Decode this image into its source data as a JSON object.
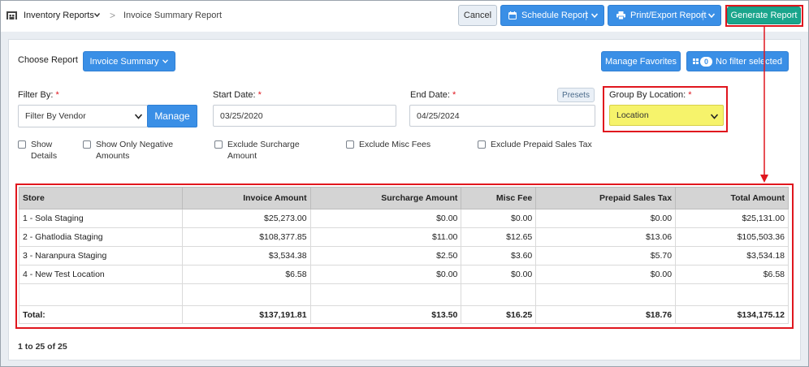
{
  "breadcrumb": {
    "module": "Inventory Reports",
    "separator": ">",
    "page": "Invoice Summary Report"
  },
  "toolbar": {
    "cancel_label": "Cancel",
    "schedule_label": "Schedule Report",
    "print_label": "Print/Export Report",
    "generate_label": "Generate Report"
  },
  "report": {
    "choose_label": "Choose Report",
    "selected": "Invoice Summary",
    "favorites_label": "Manage Favorites",
    "filter_count": "0",
    "filter_label": "No filter selected"
  },
  "filters": {
    "filter_by_label": "Filter By:",
    "filter_by_value": "Filter By Vendor",
    "manage_label": "Manage",
    "start_label": "Start Date:",
    "start_value": "03/25/2020",
    "end_label": "End Date:",
    "end_value": "04/25/2024",
    "presets_label": "Presets",
    "group_label": "Group By Location:",
    "group_value": "Location",
    "required_mark": "*"
  },
  "checkboxes": [
    {
      "line1": "Show",
      "line2": "Details"
    },
    {
      "line1": "Show Only Negative",
      "line2": "Amounts"
    },
    {
      "line1": "Exclude Surcharge",
      "line2": "Amount"
    },
    {
      "line1": "Exclude Misc Fees",
      "line2": ""
    },
    {
      "line1": "Exclude Prepaid Sales Tax",
      "line2": ""
    }
  ],
  "table": {
    "columns": [
      "Store",
      "Invoice Amount",
      "Surcharge Amount",
      "Misc Fee",
      "Prepaid Sales Tax",
      "Total Amount"
    ],
    "rows": [
      [
        "1 - Sola Staging",
        "$25,273.00",
        "$0.00",
        "$0.00",
        "$0.00",
        "$25,131.00"
      ],
      [
        "2 - Ghatlodia Staging",
        "$108,377.85",
        "$11.00",
        "$12.65",
        "$13.06",
        "$105,503.36"
      ],
      [
        "3 - Naranpura Staging",
        "$3,534.38",
        "$2.50",
        "$3.60",
        "$5.70",
        "$3,534.18"
      ],
      [
        "4 - New Test Location",
        "$6.58",
        "$0.00",
        "$0.00",
        "$0.00",
        "$6.58"
      ]
    ],
    "total": [
      "Total:",
      "$137,191.81",
      "$13.50",
      "$16.25",
      "$18.76",
      "$134,175.12"
    ]
  },
  "pager": "1 to 25 of 25",
  "colors": {
    "accent": "#3a8fe6",
    "generate": "#1aa58c",
    "highlight": "#e0161e",
    "location_fill": "#f6f36b"
  },
  "icons": {
    "module": "warehouse-icon",
    "schedule": "calendar-icon",
    "print": "printer-icon",
    "filter": "filter-icon"
  }
}
